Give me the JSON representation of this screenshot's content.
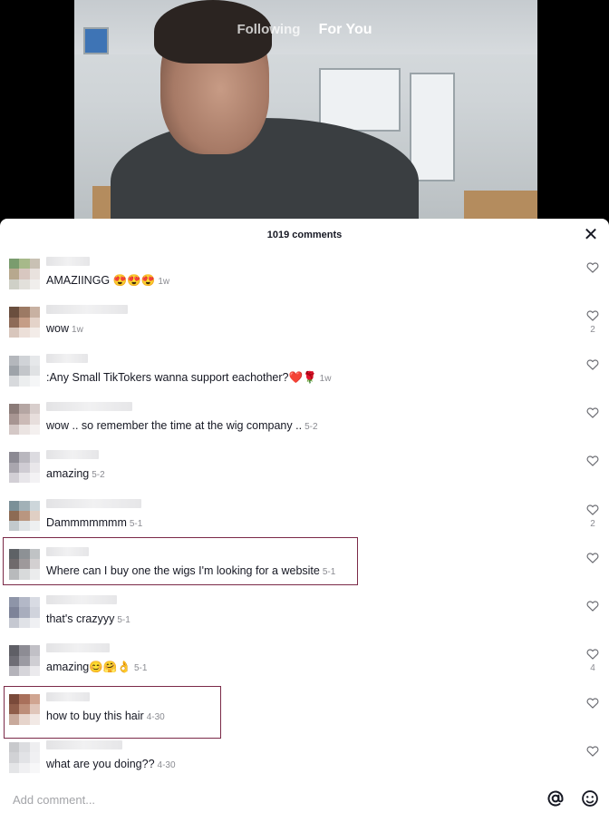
{
  "tabs": {
    "following": "Following",
    "for_you": "For You"
  },
  "comments_header": {
    "count_label": "1019 comments",
    "close_glyph": "✕"
  },
  "comments": [
    {
      "text": "AMAZIINGG 😍😍😍",
      "time": "1w",
      "likes": ""
    },
    {
      "text": "wow",
      "time": "1w",
      "likes": "2"
    },
    {
      "text": ":Any Small TikTokers wanna support eachother?❤️🌹",
      "time": "1w",
      "likes": ""
    },
    {
      "text": "wow .. so remember the time at the wig company ..",
      "time": "5-2",
      "likes": ""
    },
    {
      "text": "amazing",
      "time": "5-2",
      "likes": ""
    },
    {
      "text": "Dammmmmmm",
      "time": "5-1",
      "likes": "2"
    },
    {
      "text": "Where can I buy one the wigs I'm looking for a website",
      "time": "5-1",
      "likes": ""
    },
    {
      "text": "that's crazyyy",
      "time": "5-1",
      "likes": ""
    },
    {
      "text": "amazing😊🤗👌",
      "time": "5-1",
      "likes": "4"
    },
    {
      "text": "how to buy this hair",
      "time": "4-30",
      "likes": ""
    },
    {
      "text": "what are you doing??",
      "time": "4-30",
      "likes": ""
    }
  ],
  "input": {
    "placeholder": "Add comment...",
    "value": ""
  },
  "icons": {
    "at": "at-mention-icon",
    "emoji": "emoji-icon",
    "like": "heart-outline-icon",
    "close": "close-icon"
  },
  "colors": {
    "highlight_border": "#7b2a48",
    "text_primary": "#161823",
    "text_secondary": "#8a8b91"
  }
}
